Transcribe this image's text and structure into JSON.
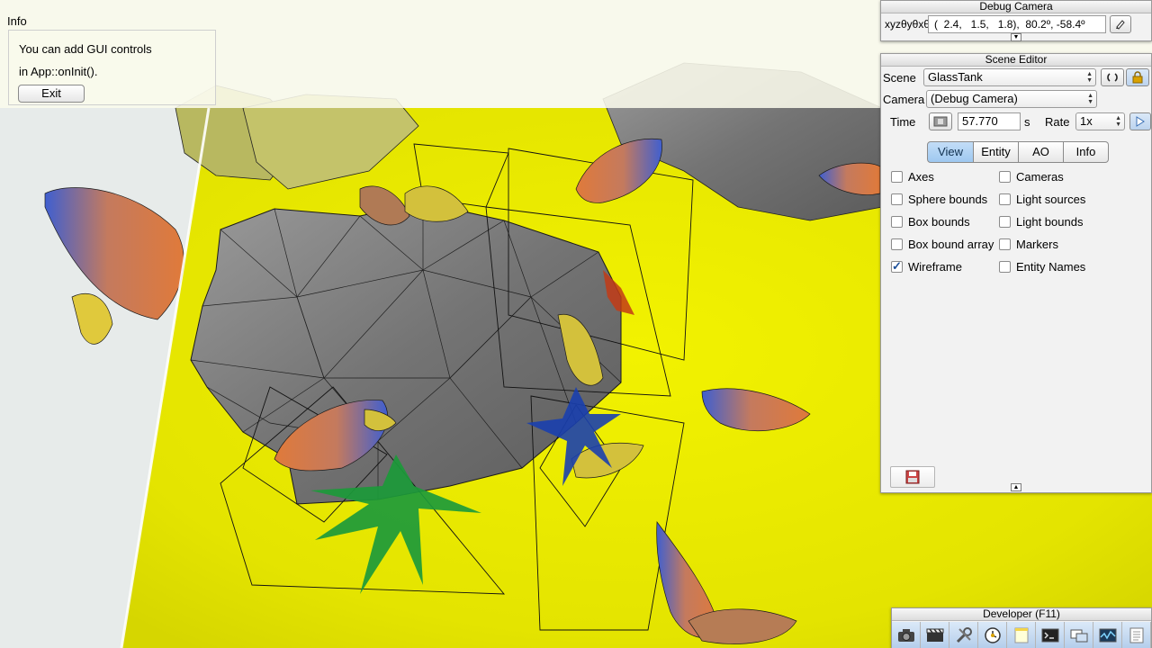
{
  "info": {
    "title": "Info",
    "line1": "You can add GUI controls",
    "line2": "in App::onInit().",
    "exit_label": "Exit"
  },
  "debug_camera": {
    "title": "Debug Camera",
    "label": "xyzθyθxθz",
    "value": "(  2.4,   1.5,   1.8),  80.2º, -58.4º"
  },
  "scene_editor": {
    "title": "Scene Editor",
    "scene_label": "Scene",
    "scene_value": "GlassTank",
    "camera_label": "Camera",
    "camera_value": "(Debug Camera)",
    "time_label": "Time",
    "time_value": "57.770",
    "time_unit": "s",
    "rate_label": "Rate",
    "rate_value": "1x",
    "tabs": [
      {
        "label": "View",
        "active": true
      },
      {
        "label": "Entity",
        "active": false
      },
      {
        "label": "AO",
        "active": false
      },
      {
        "label": "Info",
        "active": false
      }
    ],
    "options_left": [
      {
        "label": "Axes",
        "checked": false
      },
      {
        "label": "Sphere bounds",
        "checked": false
      },
      {
        "label": "Box bounds",
        "checked": false
      },
      {
        "label": "Box bound array",
        "checked": false
      },
      {
        "label": "Wireframe",
        "checked": true
      }
    ],
    "options_right": [
      {
        "label": "Cameras",
        "checked": false
      },
      {
        "label": "Light sources",
        "checked": false
      },
      {
        "label": "Light bounds",
        "checked": false
      },
      {
        "label": "Markers",
        "checked": false
      },
      {
        "label": "Entity Names",
        "checked": false
      }
    ]
  },
  "developer": {
    "title": "Developer (F11)",
    "tools": [
      "camera-icon",
      "clapperboard-icon",
      "wrench-icon",
      "clock-icon",
      "note-icon",
      "console-icon",
      "window-icon",
      "graph-icon",
      "document-icon"
    ]
  },
  "colors": {
    "floor_yellow": "#e6e600",
    "rock_gray": "#7b7b7b",
    "selected_tab": "#a9d0f5"
  }
}
